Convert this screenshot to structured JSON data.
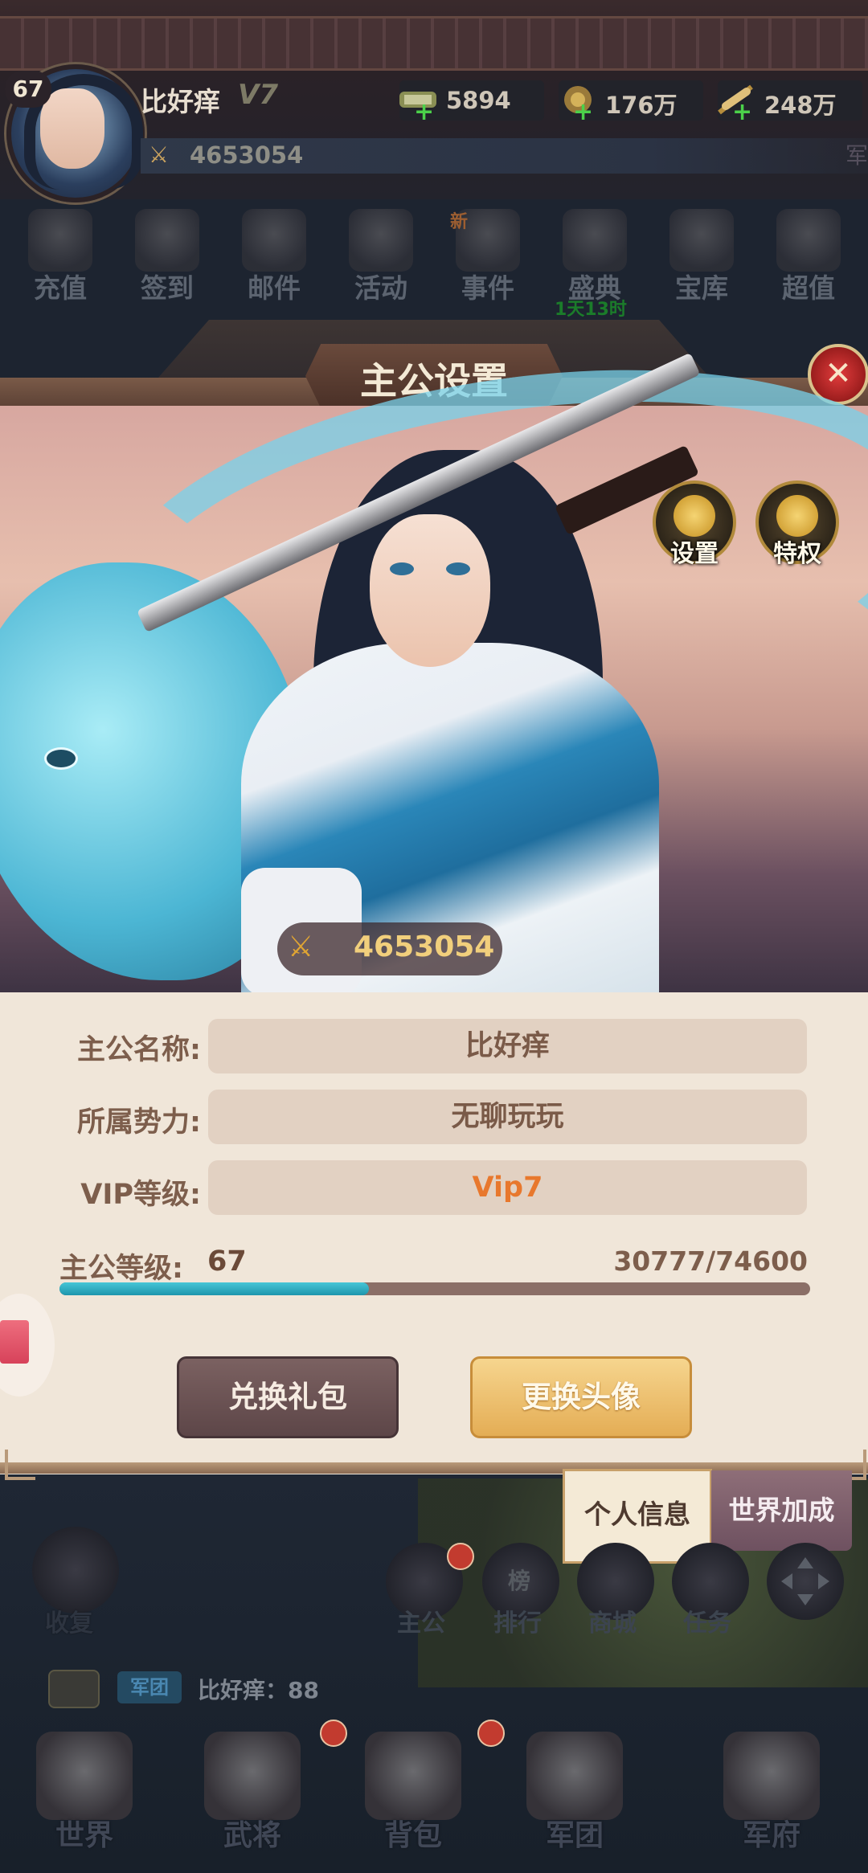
{
  "player": {
    "level": "67",
    "name": "比好痒",
    "vip": "V7",
    "power": "4653054",
    "edge_text": "军"
  },
  "resources": [
    {
      "icon": "scroll-icon",
      "value": "5894"
    },
    {
      "icon": "coin-pouch-icon",
      "value": "176万"
    },
    {
      "icon": "grain-icon",
      "value": "248万"
    }
  ],
  "menu": {
    "items": [
      {
        "icon": "recharge-icon",
        "label": "充值"
      },
      {
        "icon": "checkin-icon",
        "label": "签到"
      },
      {
        "icon": "mail-icon",
        "label": "邮件"
      },
      {
        "icon": "activity-icon",
        "label": "活动"
      },
      {
        "icon": "event-icon",
        "label": "事件"
      },
      {
        "icon": "festival-icon",
        "label": "盛典"
      },
      {
        "icon": "treasury-icon",
        "label": "宝库"
      },
      {
        "icon": "super-value-icon",
        "label": "超值"
      }
    ],
    "new_tag": "新",
    "festival_timer": "1天13时"
  },
  "dialog": {
    "title": "主公设置",
    "close_symbol": "✕",
    "settings_label": "设置",
    "privilege_label": "特权",
    "hero_power": "4653054",
    "fields": [
      {
        "label": "主公名称:",
        "value": "比好痒"
      },
      {
        "label": "所属势力:",
        "value": "无聊玩玩"
      },
      {
        "label": "VIP等级:",
        "value": "Vip7"
      }
    ],
    "level_label": "主公等级:",
    "level_value": "67",
    "exp_text": "30777/74600",
    "exp_current": 30777,
    "exp_max": 74600,
    "redeem_button": "兑换礼包",
    "change_avatar_button": "更换头像",
    "tabs": [
      "个人信息",
      "世界加成"
    ]
  },
  "lower": {
    "recover_label": "收复",
    "shortcuts": [
      "主公",
      "排行",
      "商城",
      "任务"
    ],
    "rank_glyph": "榜",
    "chat_tag": "军团",
    "chat_message": "比好痒：88"
  },
  "nav": [
    {
      "icon": "world-icon",
      "label": "世界"
    },
    {
      "icon": "general-icon",
      "label": "武将"
    },
    {
      "icon": "backpack-icon",
      "label": "背包"
    },
    {
      "icon": "legion-icon",
      "label": "军团"
    },
    {
      "icon": "mansion-icon",
      "label": "军府"
    }
  ],
  "colors": {
    "accent_gold": "#e4ad55",
    "vip_orange": "#e8782d",
    "exp_bar": "#1e95ac",
    "panel_bg": "#f0e6d9"
  }
}
